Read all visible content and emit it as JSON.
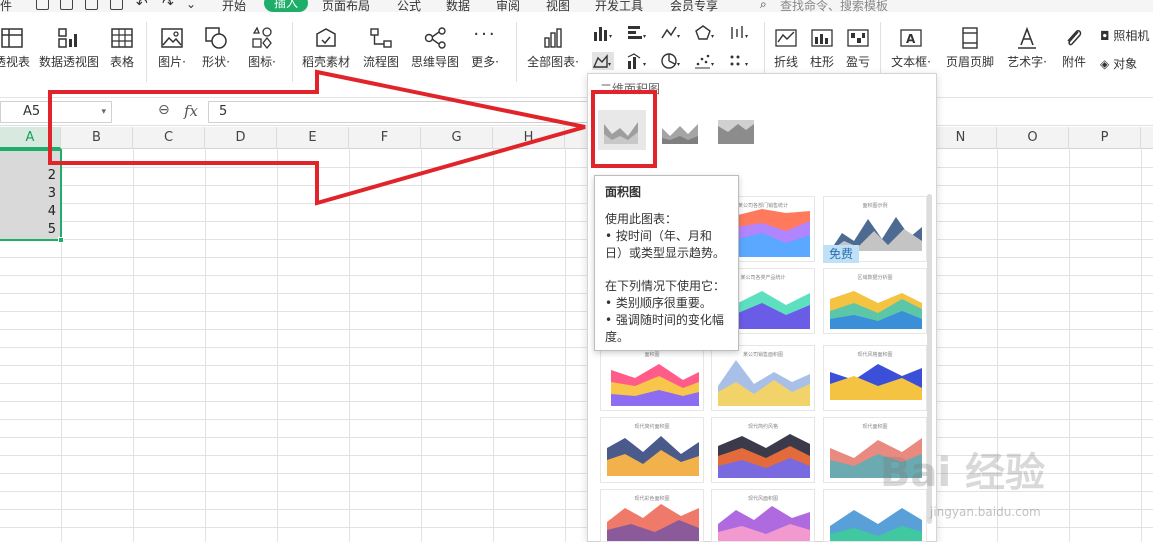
{
  "menu": {
    "items": [
      "件",
      "开始",
      "插入",
      "页面布局",
      "公式",
      "数据",
      "审阅",
      "视图",
      "开发工具",
      "会员专享"
    ],
    "active": "插入",
    "search_placeholder": "查找命令、搜索模板"
  },
  "ribbon": {
    "buttons": [
      {
        "label": "透视表"
      },
      {
        "label": "数据透视图"
      },
      {
        "label": "表格"
      },
      {
        "label": "图片·"
      },
      {
        "label": "形状·"
      },
      {
        "label": "图标·"
      },
      {
        "label": "稻壳素材"
      },
      {
        "label": "流程图"
      },
      {
        "label": "思维导图"
      },
      {
        "label": "更多·"
      },
      {
        "label": "全部图表·"
      },
      {
        "label": "折线"
      },
      {
        "label": "柱形"
      },
      {
        "label": "盈亏"
      },
      {
        "label": "文本框·"
      },
      {
        "label": "页眉页脚"
      },
      {
        "label": "艺术字·"
      },
      {
        "label": "附件"
      }
    ],
    "right_small": [
      "照相机",
      "对象"
    ]
  },
  "formula_bar": {
    "name_box": "A5",
    "fx": "fx",
    "value": "5"
  },
  "columns": [
    "A",
    "B",
    "C",
    "D",
    "E",
    "F",
    "G",
    "H",
    "N",
    "O",
    "P"
  ],
  "cells_a": [
    "2",
    "3",
    "4",
    "5"
  ],
  "panel": {
    "section_title": "二维面积图",
    "badge": "免费",
    "template_titles": [
      "某公司各部门销售统计",
      "面积图示例",
      "某公司各类产品统计",
      "区域数据分析图",
      "面积图",
      "某公司销售面积图",
      "现代风格面积图",
      "现代简约面积图",
      "现代简约风格",
      "现代面积图",
      "现代彩色面积图",
      "现代风面积图"
    ]
  },
  "tooltip": {
    "title": "面积图",
    "line1": "使用此图表：",
    "line2": "• 按时间（年、月和日）或类型显示趋势。",
    "line3": "在下列情况下使用它：",
    "line4": "• 类别顺序很重要。",
    "line5": "• 强调随时间的变化幅度。"
  },
  "watermark": "Bai 经验",
  "watermark_url": "jingyan.baidu.com",
  "colors": {
    "accent": "#1fae6a",
    "annotation": "#e0242a"
  }
}
